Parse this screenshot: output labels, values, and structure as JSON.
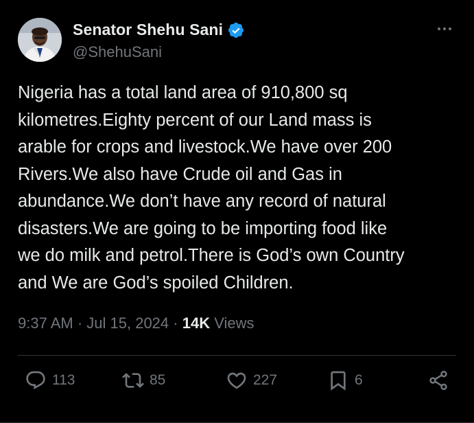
{
  "author": {
    "display_name": "Senator Shehu Sani",
    "handle": "@ShehuSani",
    "verified": true,
    "avatar_icon": "profile-photo"
  },
  "tweet": {
    "text": "Nigeria has a total land area of 910,800 sq\nkilometres.Eighty percent of our Land mass is\narable for crops and livestock.We have over 200\nRivers.We also have Crude oil and Gas in\nabundance.We don’t have any record of natural\ndisasters.We are going to be importing food like\nwe do milk and petrol.There is God’s own Country\nand We are God’s spoiled Children."
  },
  "meta": {
    "time": "9:37 AM",
    "separator": " · ",
    "date": "Jul 15, 2024",
    "views_count": "14K",
    "views_label": " Views"
  },
  "actions": {
    "replies": "113",
    "reposts": "85",
    "likes": "227",
    "bookmarks": "6"
  },
  "colors": {
    "background": "#000000",
    "text": "#e7e9ea",
    "muted": "#71767b",
    "verified_badge": "#1d9bf0",
    "divider": "#2f3336"
  }
}
